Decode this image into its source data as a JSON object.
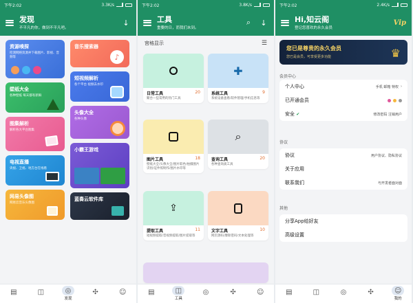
{
  "status": {
    "time": "下午2:02",
    "speed1": "3.3K/s",
    "speed2": "3.8K/s",
    "speed3": "2.4K/s"
  },
  "screen1": {
    "title": "发现",
    "subtitle": "不平凡的你，做到不平凡吧。",
    "cards_left": [
      {
        "name": "资源嗅探",
        "desc": "检测网络资源并下载图片、影视、音频等"
      },
      {
        "name": "壁纸大全",
        "desc": "各种壁纸 每天都有新鲜"
      },
      {
        "name": "图集解析",
        "desc": "解析各大平台图集"
      },
      {
        "name": "电视直播",
        "desc": "央视、卫视、地方台在线看"
      },
      {
        "name": "网易头像图",
        "desc": "网易云音乐头像图"
      }
    ],
    "cards_right": [
      {
        "name": "音乐搜索器",
        "desc": ""
      },
      {
        "name": "短视频解析",
        "desc": "各个平台 视频去水印"
      },
      {
        "name": "头像大全",
        "desc": "各种头像"
      },
      {
        "name": "小霸王游戏",
        "desc": ""
      },
      {
        "name": "蓝奏云软件库",
        "desc": ""
      }
    ],
    "nav_active": "发现"
  },
  "screen2": {
    "title": "工具",
    "subtitle": "重要的日，而我们未到。",
    "view_label": "宫格显示",
    "tools": [
      {
        "name": "日常工具",
        "count": "20",
        "desc": "聚合一些常用的热门工具"
      },
      {
        "name": "系统工具",
        "count": "9",
        "desc": "系统设备查看/软件管理/手机信息等"
      },
      {
        "name": "图片工具",
        "count": "18",
        "desc": "壁纸大全/头像大全/图片取色/拍摄图片识别/证件照制作/图片水印等"
      },
      {
        "name": "查询工具",
        "count": "20",
        "desc": "各种查询类工具"
      },
      {
        "name": "提取工具",
        "count": "11",
        "desc": "短视频提取/音视频提取/图片提取等"
      },
      {
        "name": "文字工具",
        "count": "10",
        "desc": "网页源码/摩斯密码/文本处理等"
      }
    ],
    "nav_active": "工具"
  },
  "screen3": {
    "title": "Hi,知云阁",
    "subtitle": "登记您喜欢的永久会员",
    "vip_title": "您已是尊贵的永久会员",
    "vip_sub": "您已是会员，可享受更多功能",
    "sections": [
      {
        "label": "会员中心",
        "rows": [
          {
            "name": "个人中心",
            "value": "手机 邮箱 特权"
          },
          {
            "name": "已开通会员",
            "value": ""
          },
          {
            "name": "安全",
            "value": "修改密码 注销用户"
          }
        ]
      },
      {
        "label": "协议",
        "rows": [
          {
            "name": "协议",
            "value": "用户协议、隐私协议"
          },
          {
            "name": "关于应用",
            "value": ""
          },
          {
            "name": "联系我们",
            "value": "与开发者面对面"
          }
        ]
      },
      {
        "label": "其他",
        "rows": [
          {
            "name": "分享App给好友",
            "value": ""
          },
          {
            "name": "高级设置",
            "value": ""
          }
        ]
      }
    ],
    "nav_active": "我的"
  }
}
